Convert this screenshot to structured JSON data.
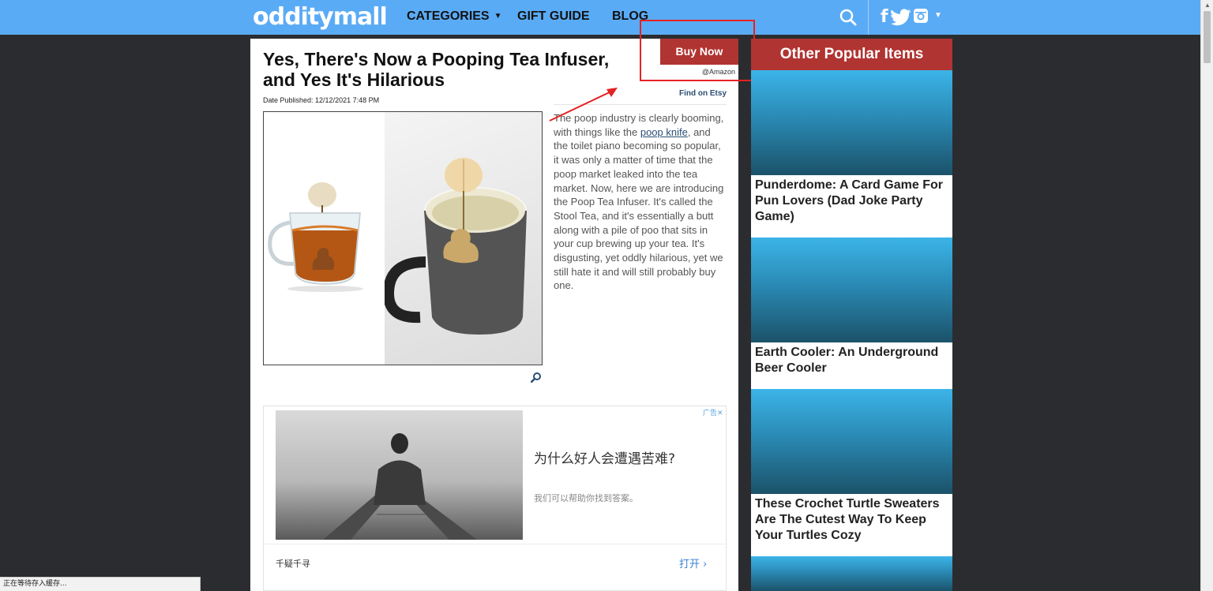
{
  "brand": {
    "logo_text": "odditymall"
  },
  "nav": {
    "items": [
      {
        "label": "CATEGORIES",
        "has_caret": true
      },
      {
        "label": "GIFT GUIDE",
        "has_caret": false
      },
      {
        "label": "BLOG",
        "has_caret": false
      }
    ],
    "social": {
      "facebook": "f",
      "twitter": "twitter-icon",
      "instagram": "instagram-icon"
    }
  },
  "article": {
    "title": "Yes, There's Now a Pooping Tea Infuser, and Yes It's Hilarious",
    "date": "Date Published: 12/12/2021 7:48 PM",
    "buy_button": "Buy Now",
    "buy_source": "@Amazon",
    "find_etsy": "Find on Etsy",
    "body": {
      "part1": "The poop industry is clearly booming, with things like the ",
      "link": "poop knife",
      "part2": ", and the toilet piano becoming so popular, it was only a matter of time that the poop market leaked into the tea market. Now, here we are introducing the Poop Tea Infuser. It's called the Stool Tea, and it's essentially a butt along with a pile of poo that sits in your cup brewing up your tea. It's disgusting, yet oddly hilarious, yet we still hate it and will still probably buy one."
    }
  },
  "ad": {
    "badge": "广告✕",
    "title": "为什么好人会遭遇苦难?",
    "subtitle": "我们可以帮助你找到答案。",
    "brand": "千疑千寻",
    "open": "打开 ›"
  },
  "sidebar": {
    "heading": "Other Popular Items",
    "items": [
      {
        "title": "Punderdome: A Card Game For Pun Lovers (Dad Joke Party Game)"
      },
      {
        "title": "Earth Cooler: An Underground Beer Cooler"
      },
      {
        "title": "These Crochet Turtle Sweaters Are The Cutest Way To Keep Your Turtles Cozy"
      },
      {
        "title": ""
      }
    ]
  },
  "status_bar": {
    "text": "正在等待存入缓存..."
  },
  "colors": {
    "nav_bg": "#5aabf5",
    "page_bg": "#2b2c2f",
    "accent_red": "#b03432",
    "link_blue": "#2b4f74",
    "annotation_red": "#e52222"
  }
}
